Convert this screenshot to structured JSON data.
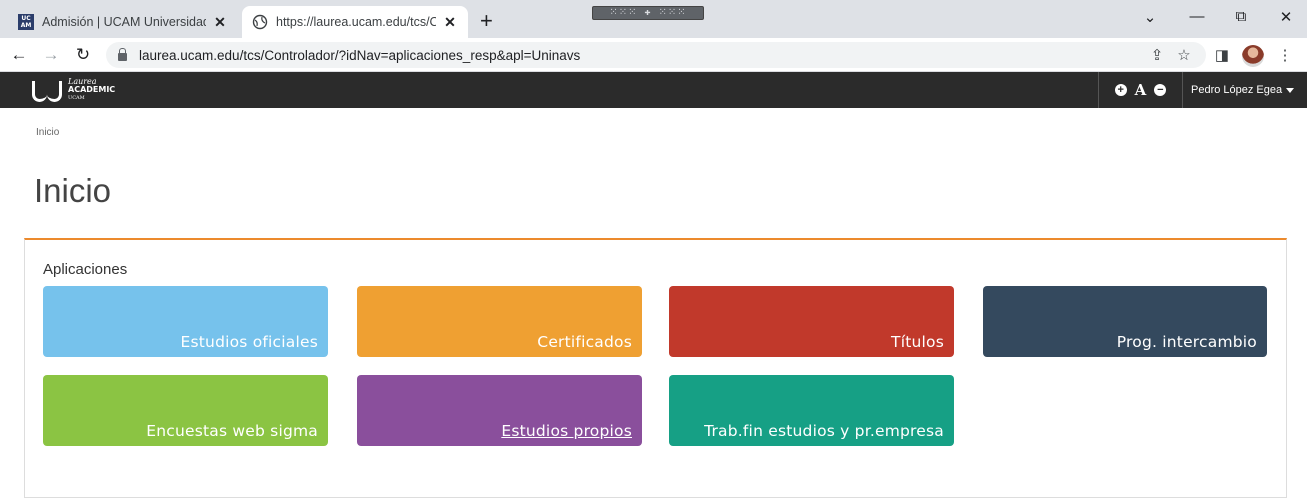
{
  "browser": {
    "tabs": [
      {
        "title": "Admisión | UCAM Universidad Ca",
        "favicon": "ucam-icon"
      },
      {
        "title": "https://laurea.ucam.edu/tcs/Cont",
        "favicon": "globe-icon"
      }
    ],
    "new_tab": "+",
    "url": "laurea.ucam.edu/tcs/Controlador/?idNav=aplicaciones_resp&apl=Uninavs",
    "controls": {
      "minimize": "—",
      "restore": "⧉",
      "close": "✕",
      "dropdown": "⌄"
    }
  },
  "header": {
    "logo": {
      "line1": "Laurea",
      "line2": "ACADEMIC",
      "line3": "UCAM"
    },
    "font_controls": {
      "increase": "+",
      "letter": "A",
      "decrease": "−"
    },
    "user_name": "Pedro López Egea"
  },
  "breadcrumb": "Inicio",
  "page_title": "Inicio",
  "panel": {
    "title": "Aplicaciones",
    "tiles": [
      {
        "label": "Estudios oficiales",
        "color": "#76c2ec"
      },
      {
        "label": "Certificados",
        "color": "#efa032"
      },
      {
        "label": "Títulos",
        "color": "#c1392b"
      },
      {
        "label": "Prog. intercambio",
        "color": "#34495e"
      },
      {
        "label": "Encuestas web sigma",
        "color": "#8bc443"
      },
      {
        "label": "Estudios propios",
        "color": "#8a4f9c"
      },
      {
        "label": "Trab.fin estudios y pr.empresa",
        "color": "#16a085"
      }
    ]
  }
}
